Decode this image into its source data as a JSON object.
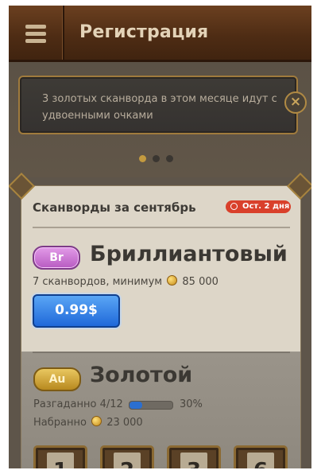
{
  "header": {
    "title": "Регистрация",
    "menu_icon": "hamburger-menu-icon"
  },
  "notice": {
    "text": "3 золотых сканворда в этом месяце идут с удвоенными очками",
    "close_icon": "close-icon"
  },
  "pager": {
    "dots": 3,
    "active": 0
  },
  "month_section": {
    "title": "Сканворды за сентябрь",
    "badge": "Ост. 2 дня",
    "badge_icon": "clock-icon"
  },
  "tier_brilliant": {
    "badge": "Br",
    "name": "Бриллиантовый",
    "desc": "7 сканвордов, минимум",
    "min_points": "85 000",
    "price": "0.99$"
  },
  "tier_gold": {
    "badge": "Au",
    "name": "Золотой",
    "solved_label": "Разгаданно",
    "solved": "4/12",
    "progress_percent": "30%",
    "progress": 0.3,
    "points_label": "Набранно",
    "points": "23 000"
  },
  "puzzles": [
    "1",
    "2",
    "3",
    "6"
  ],
  "colors": {
    "accent_blue": "#1f68d9",
    "badge_red": "#d9402b",
    "gold": "#b8891f",
    "wood": "#4e2c14"
  }
}
